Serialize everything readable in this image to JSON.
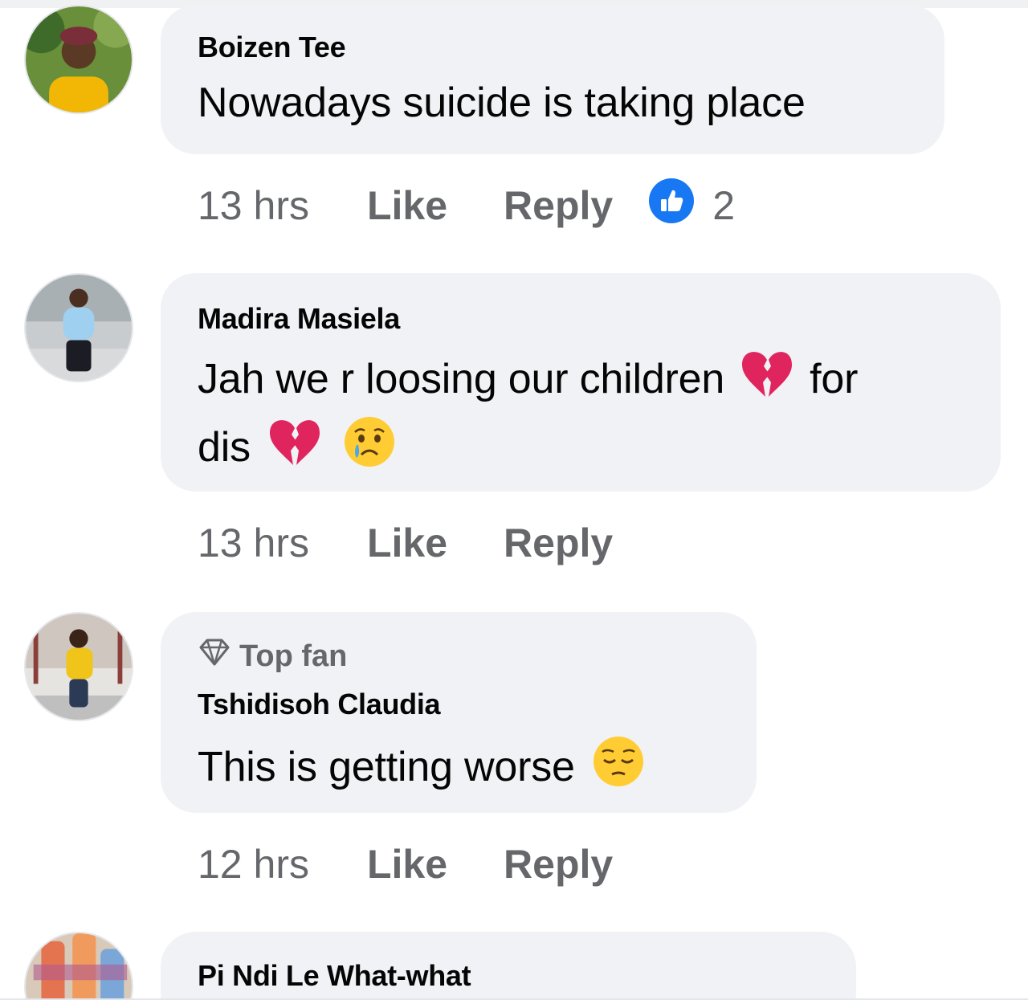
{
  "colors": {
    "bubble": "#f0f2f5",
    "meta_text": "#65676b",
    "like_blue": "#1877f2",
    "heart_red": "#e0245e",
    "emoji_yellow": "#ffcc33"
  },
  "comments": [
    {
      "author": "Boizen Tee",
      "text": "Nowadays suicide is taking place",
      "time": "13 hrs",
      "like_label": "Like",
      "reply_label": "Reply",
      "reaction_icon": "thumbs-up-icon",
      "reaction_count": "2"
    },
    {
      "author": "Madira Masiela",
      "text_line1": "Jah we r loosing our children",
      "text_line1_after": "for",
      "text_line2": "dis",
      "emojis": [
        "broken-heart-icon",
        "broken-heart-icon",
        "crying-face-icon"
      ],
      "time": "13 hrs",
      "like_label": "Like",
      "reply_label": "Reply"
    },
    {
      "badge": "Top fan",
      "badge_icon": "diamond-icon",
      "author": "Tshidisoh Claudia",
      "text": "This is getting worse",
      "emojis": [
        "pensive-face-icon"
      ],
      "time": "12 hrs",
      "like_label": "Like",
      "reply_label": "Reply"
    },
    {
      "author": "Pi Ndi Le What-what"
    }
  ]
}
